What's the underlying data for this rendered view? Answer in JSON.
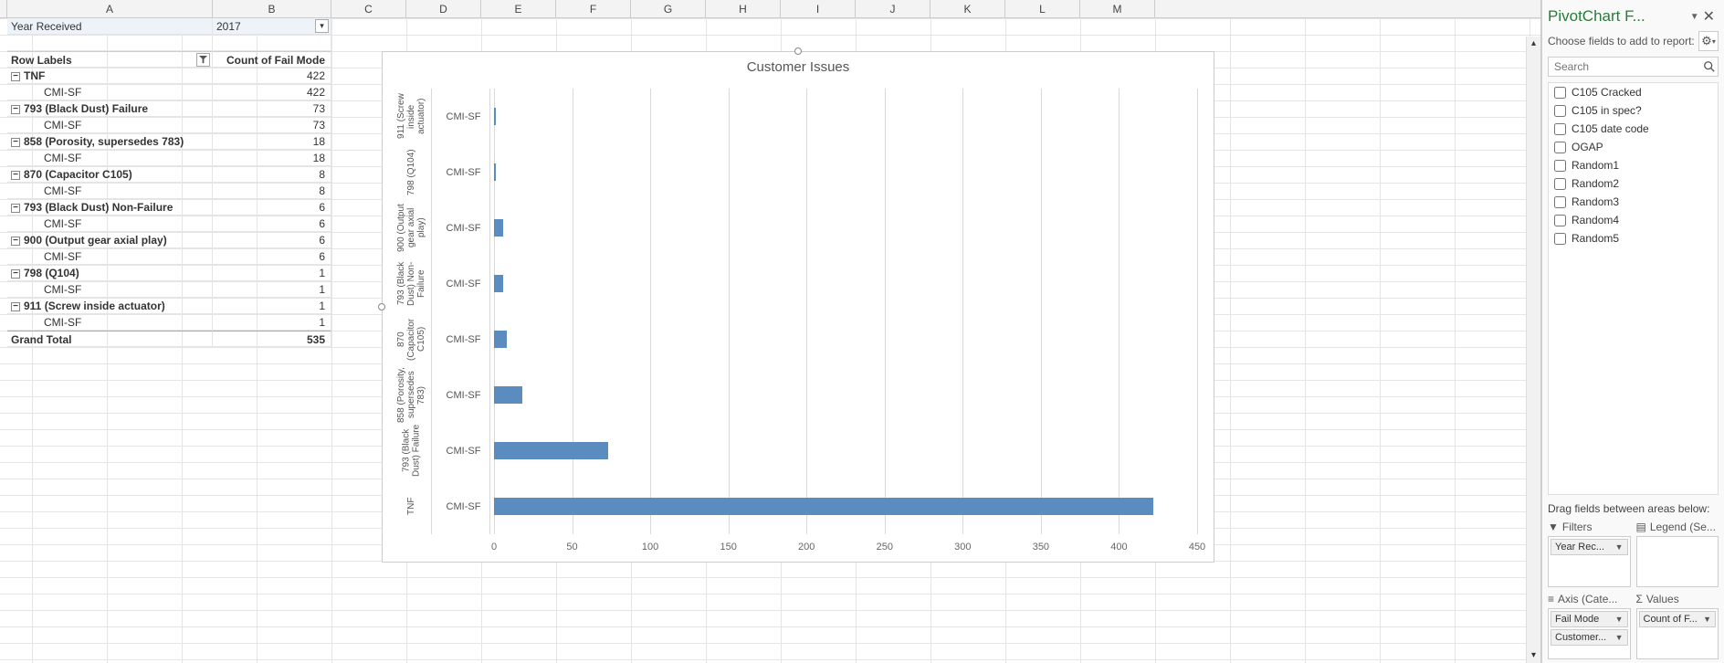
{
  "cols": [
    "A",
    "B",
    "C",
    "D",
    "E",
    "F",
    "G",
    "H",
    "I",
    "J",
    "K",
    "L",
    "M"
  ],
  "pivot": {
    "filter_label": "Year Received",
    "filter_value": "2017",
    "header_rowlabels": "Row Labels",
    "header_count": "Count of Fail Mode",
    "rows": [
      {
        "lvl": 0,
        "exp": true,
        "label": "TNF",
        "val": "422"
      },
      {
        "lvl": 1,
        "label": "CMI-SF",
        "val": "422"
      },
      {
        "lvl": 0,
        "exp": true,
        "label": "793 (Black Dust) Failure",
        "val": "73"
      },
      {
        "lvl": 1,
        "label": "CMI-SF",
        "val": "73"
      },
      {
        "lvl": 0,
        "exp": true,
        "label": "858 (Porosity, supersedes 783)",
        "val": "18"
      },
      {
        "lvl": 1,
        "label": "CMI-SF",
        "val": "18"
      },
      {
        "lvl": 0,
        "exp": true,
        "label": "870 (Capacitor C105)",
        "val": "8"
      },
      {
        "lvl": 1,
        "label": "CMI-SF",
        "val": "8"
      },
      {
        "lvl": 0,
        "exp": true,
        "label": "793 (Black Dust) Non-Failure",
        "val": "6"
      },
      {
        "lvl": 1,
        "label": "CMI-SF",
        "val": "6"
      },
      {
        "lvl": 0,
        "exp": true,
        "label": "900 (Output gear axial play)",
        "val": "6"
      },
      {
        "lvl": 1,
        "label": "CMI-SF",
        "val": "6"
      },
      {
        "lvl": 0,
        "exp": true,
        "label": "798 (Q104)",
        "val": "1"
      },
      {
        "lvl": 1,
        "label": "CMI-SF",
        "val": "1"
      },
      {
        "lvl": 0,
        "exp": true,
        "label": "911 (Screw inside actuator)",
        "val": "1"
      },
      {
        "lvl": 1,
        "label": "CMI-SF",
        "val": "1"
      }
    ],
    "grand_label": "Grand Total",
    "grand_val": "535"
  },
  "chart_data": {
    "type": "bar",
    "orientation": "horizontal",
    "title": "Customer Issues",
    "xlabel": "",
    "ylabel": "",
    "xlim": [
      0,
      450
    ],
    "xticks": [
      0,
      50,
      100,
      150,
      200,
      250,
      300,
      350,
      400,
      450
    ],
    "series": [
      {
        "cat": "911 (Screw inside actuator)",
        "sub": "CMI-SF",
        "value": 1
      },
      {
        "cat": "798 (Q104)",
        "sub": "CMI-SF",
        "value": 1
      },
      {
        "cat": "900 (Output gear axial play)",
        "sub": "CMI-SF",
        "value": 6
      },
      {
        "cat": "793 (Black Dust) Non-Failure",
        "sub": "CMI-SF",
        "value": 6
      },
      {
        "cat": "870 (Capacitor C105)",
        "sub": "CMI-SF",
        "value": 8
      },
      {
        "cat": "858 (Porosity, supersedes 783)",
        "sub": "CMI-SF",
        "value": 18
      },
      {
        "cat": "793 (Black Dust) Failure",
        "sub": "CMI-SF",
        "value": 73
      },
      {
        "cat": "TNF",
        "sub": "CMI-SF",
        "value": 422
      }
    ]
  },
  "pane": {
    "title": "PivotChart F...",
    "subtitle": "Choose fields to add to report:",
    "search_placeholder": "Search",
    "fields": [
      "C105 Cracked",
      "C105 in spec?",
      "C105 date code",
      "OGAP",
      "Random1",
      "Random2",
      "Random3",
      "Random4",
      "Random5"
    ],
    "drag_label": "Drag fields between areas below:",
    "zone_filters": "Filters",
    "zone_legend": "Legend (Se...",
    "zone_axis": "Axis (Cate...",
    "zone_values": "Values",
    "chip_filters": [
      "Year Rec..."
    ],
    "chip_axis": [
      "Fail Mode",
      "Customer..."
    ],
    "chip_values": [
      "Count of F..."
    ]
  }
}
